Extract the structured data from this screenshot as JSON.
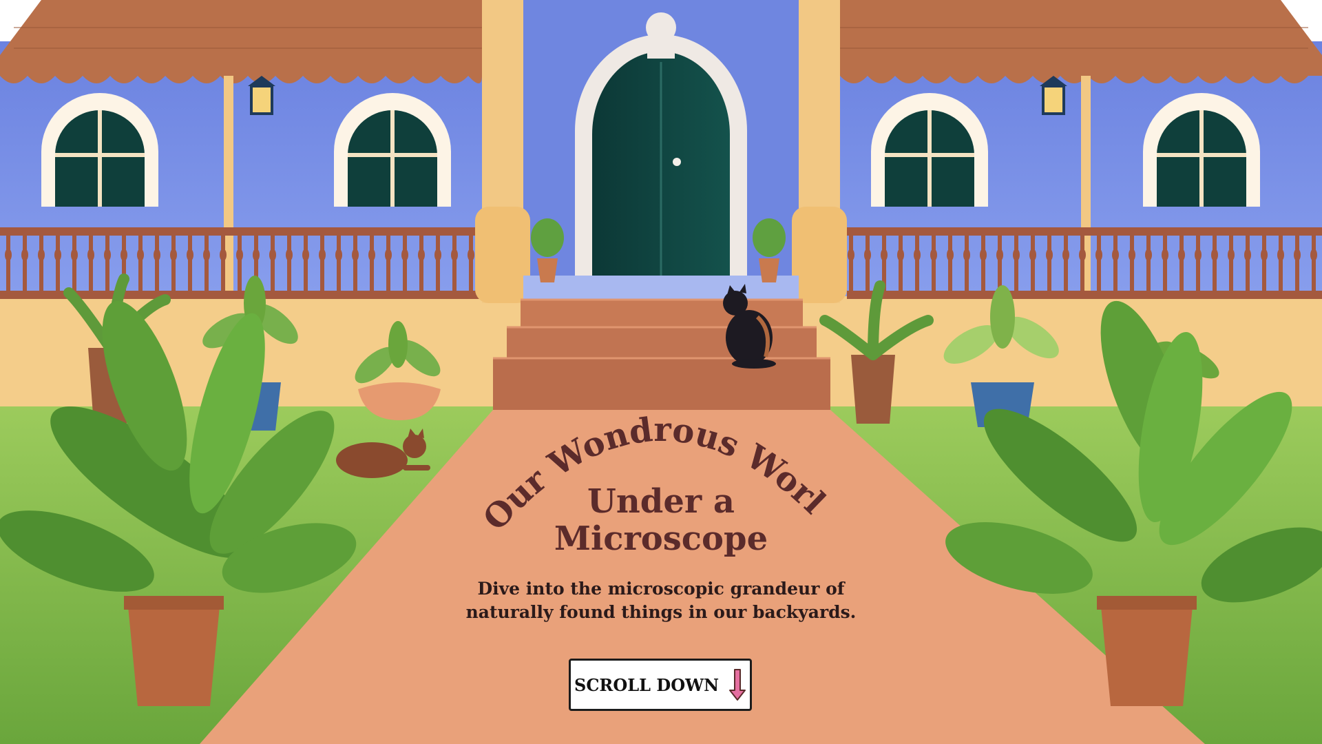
{
  "hero": {
    "title_arc": "Our Wondrous World",
    "title_line2": "Under a",
    "title_line3": "Microscope",
    "subtitle_line1": "Dive into the microscopic grandeur of",
    "subtitle_line2": "naturally found things in our backyards."
  },
  "cta": {
    "label": "SCROLL DOWN",
    "icon": "arrow-down-icon"
  },
  "colors": {
    "wall_blue": "#6f86e0",
    "roof_tile": "#b9704a",
    "path_peach": "#e9a17a",
    "grass": "#7fb24a",
    "door_green": "#0f3f3b",
    "title_brown": "#5b2b2b",
    "arrow_pink": "#e56fa0"
  }
}
